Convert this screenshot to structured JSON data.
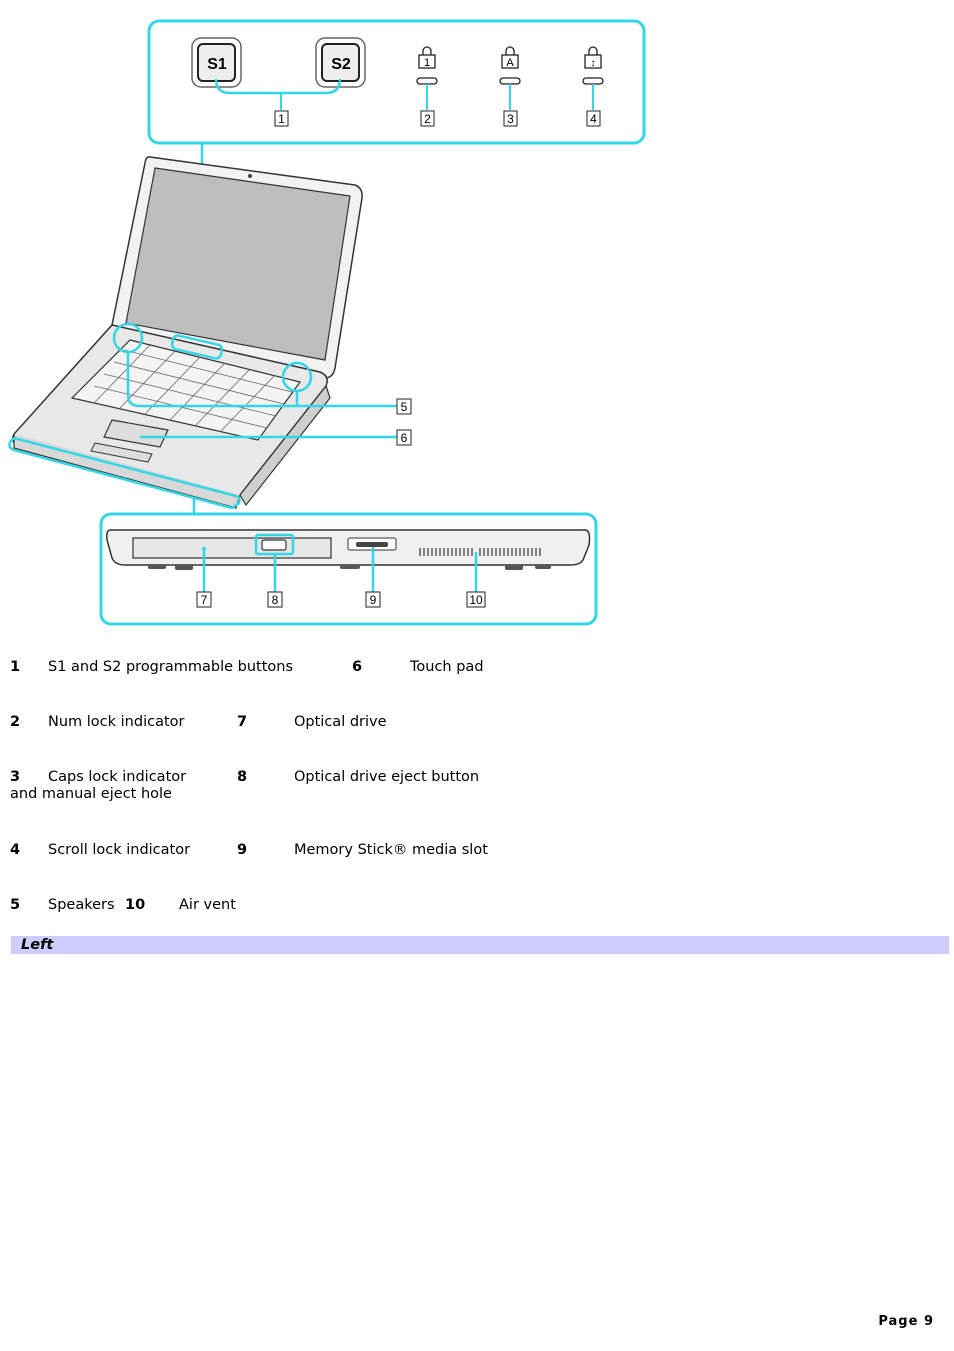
{
  "figure": {
    "top_panel": {
      "keys": [
        "S1",
        "S2"
      ],
      "indicator_glyphs": [
        "1",
        "A",
        "↕"
      ],
      "callouts": [
        "1",
        "2",
        "3",
        "4"
      ]
    },
    "laptop_callouts": [
      "5",
      "6"
    ],
    "side_panel_callouts": [
      "7",
      "8",
      "9",
      "10"
    ],
    "highlight_color": "#33d6e6"
  },
  "legend": [
    {
      "num": "1",
      "label": "S1 and S2 programmable buttons",
      "num2": "6",
      "label2": "Touch pad"
    },
    {
      "num": "2",
      "label": "Num lock indicator",
      "num2": "7",
      "label2": "Optical drive"
    },
    {
      "num": "3",
      "label": "Caps lock indicator",
      "label_cont": "and manual eject hole",
      "num2": "8",
      "label2": "Optical drive eject button"
    },
    {
      "num": "4",
      "label": "Scroll lock indicator",
      "num2": "9",
      "label2": "Memory Stick® media slot"
    },
    {
      "num": "5",
      "label": "Speakers",
      "num2": "10",
      "label2": "Air vent"
    }
  ],
  "section": {
    "title": "Left"
  },
  "footer": {
    "page": "Page 9"
  }
}
